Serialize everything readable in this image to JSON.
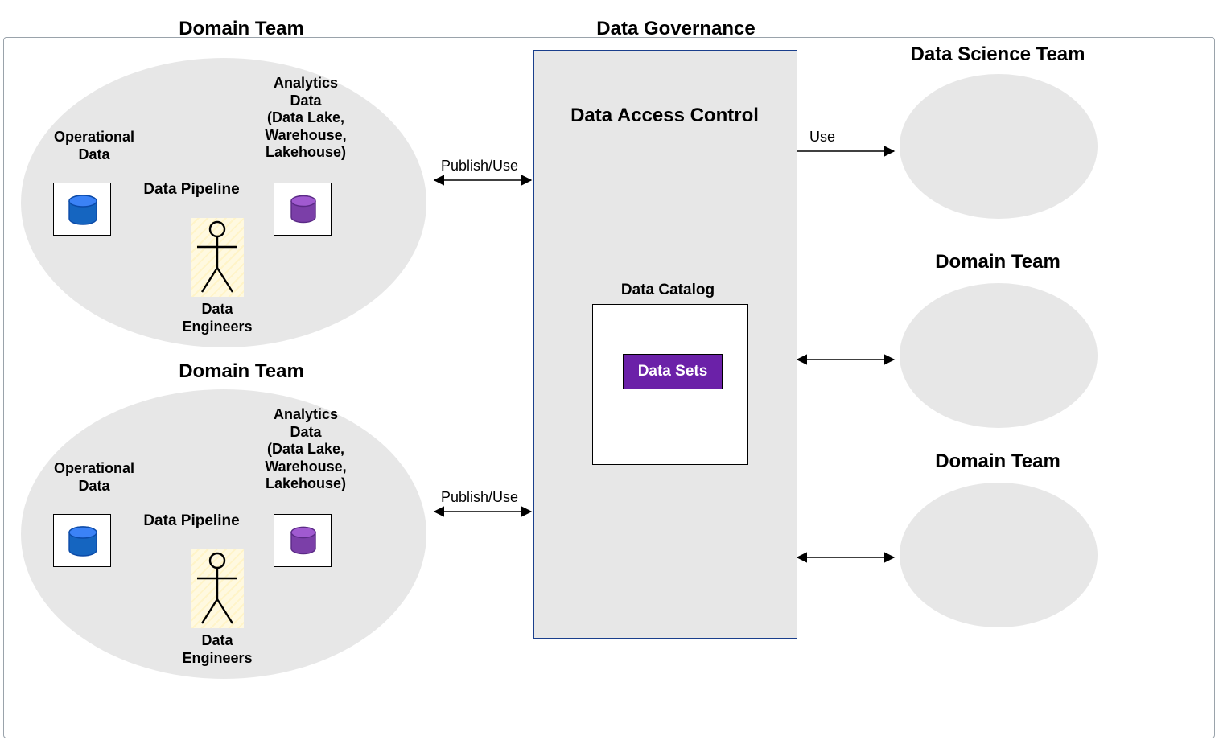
{
  "titles": {
    "domain_team": "Domain Team",
    "data_governance": "Data Governance",
    "data_science_team": "Data Science Team"
  },
  "domain_block": {
    "operational_data": "Operational\nData",
    "analytics_data": "Analytics\nData\n(Data Lake,\nWarehouse,\nLakehouse)",
    "data_pipeline": "Data Pipeline",
    "data_engineers": "Data\nEngineers"
  },
  "governance": {
    "access_control": "Data Access Control",
    "data_catalog": "Data Catalog",
    "data_sets": "Data Sets"
  },
  "arrows": {
    "publish_use": "Publish/Use",
    "use": "Use"
  },
  "colors": {
    "ellipse": "#e7e7e7",
    "gov_border": "#1a3f8c",
    "purple": "#6b21a8",
    "blue_cyl": "#1976d2",
    "purple_cyl": "#8e44ad"
  }
}
